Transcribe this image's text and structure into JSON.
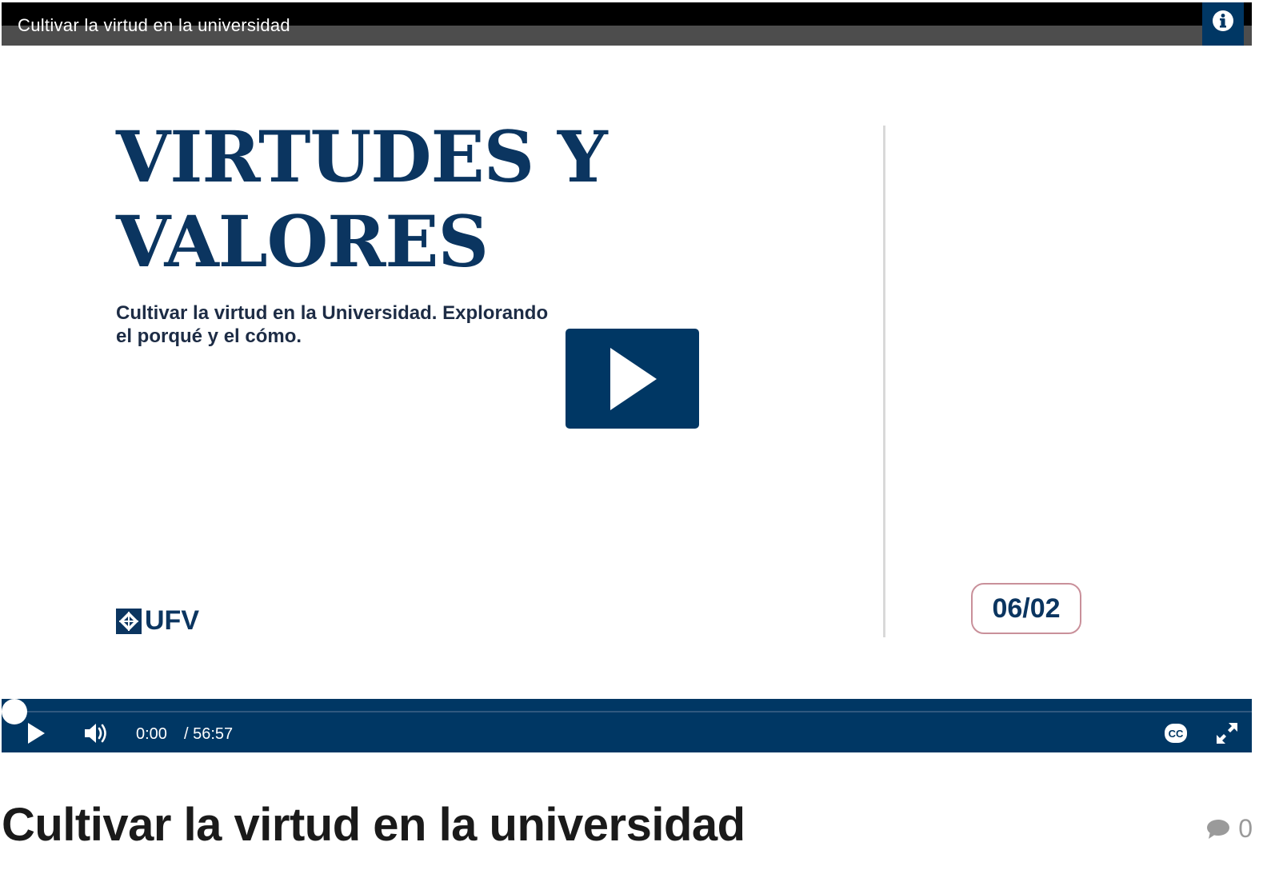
{
  "player": {
    "title": "Cultivar la virtud en la universidad",
    "info_icon": "info-icon",
    "slide": {
      "heading_line1": "VIRTUDES Y",
      "heading_line2": "VALORES",
      "subtitle_line1": "Cultivar la virtud en la Universidad. Explorando",
      "subtitle_line2": "el porqué y el cómo.",
      "logo_text": "UFV",
      "date": "06/02"
    },
    "controls": {
      "current_time": "0:00",
      "duration": "/ 56:57",
      "progress_fraction": 0.0
    },
    "colors": {
      "accent": "#003764",
      "heading": "#0b3560",
      "badge_border": "#c9909a"
    }
  },
  "page": {
    "title": "Cultivar la virtud en la universidad",
    "comment_count": "0"
  }
}
